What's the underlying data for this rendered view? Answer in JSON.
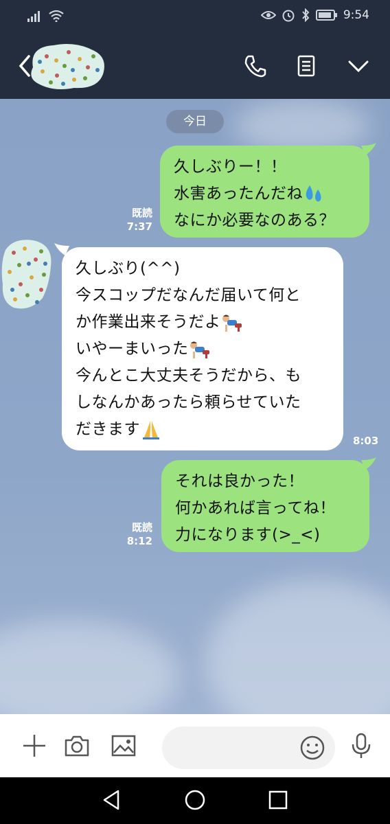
{
  "status_bar": {
    "time": "9:54"
  },
  "date_divider": "今日",
  "messages": [
    {
      "side": "me",
      "lines": [
        "久しぶりー！！",
        "水害あったんだね",
        "なにか必要なのある？"
      ],
      "read_label": "既読",
      "time": "7:37"
    },
    {
      "side": "peer",
      "lines": [
        "久しぶり(^^)",
        "今スコップだなんだ届いて何と",
        "か作業出来そうだよ",
        "いやーまいった",
        "今んとこ大丈夫そうだから、も",
        "しなんかあったら頼らせていた",
        "だきます"
      ],
      "time": "8:03"
    },
    {
      "side": "me",
      "lines": [
        "それは良かった！",
        "何かあれば言ってね！",
        "力になります(>_<)"
      ],
      "read_label": "既読",
      "time": "8:12"
    }
  ],
  "icons": {
    "back": "chevron-left-icon",
    "call": "phone-icon",
    "notes": "notes-icon",
    "menu": "chevron-down-icon",
    "add": "plus-icon",
    "camera": "camera-icon",
    "gallery": "image-icon",
    "emoji": "smiley-icon",
    "voice": "microphone-icon"
  },
  "colors": {
    "header_bg": "#232d3d",
    "my_bubble": "#9ce27e",
    "peer_bubble": "#ffffff",
    "chat_bg": "#8ea6c8"
  }
}
